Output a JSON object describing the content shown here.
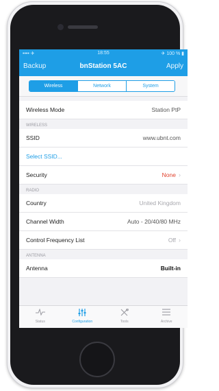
{
  "statusbar": {
    "left": "•••• ✈",
    "time": "18:55",
    "right": "✈ 100 % ▮"
  },
  "nav": {
    "back": "Backup",
    "title": "bnStation 5AC",
    "apply": "Apply"
  },
  "segments": [
    "Wireless",
    "Network",
    "System"
  ],
  "rows": {
    "wireless_mode": {
      "label": "Wireless Mode",
      "value": "Station PtP"
    },
    "section_wireless": "WIRELESS",
    "ssid": {
      "label": "SSID",
      "value": "www.ubnt.com"
    },
    "select_ssid": "Select SSID...",
    "security": {
      "label": "Security",
      "value": "None"
    },
    "section_radio": "RADIO",
    "country": {
      "label": "Country",
      "value": "United Kingdom"
    },
    "channel_width": {
      "label": "Channel Width",
      "value": "Auto - 20/40/80 MHz"
    },
    "control_freq": {
      "label": "Control Frequency List",
      "value": "Off"
    },
    "section_antenna": "ANTENNA",
    "antenna": {
      "label": "Antenna",
      "value": "Built-in"
    }
  },
  "tabbar": [
    {
      "label": "Status",
      "icon": "pulse-icon"
    },
    {
      "label": "Configuration",
      "icon": "sliders-icon"
    },
    {
      "label": "Tools",
      "icon": "tools-icon"
    },
    {
      "label": "Archive",
      "icon": "list-icon"
    }
  ],
  "colors": {
    "accent": "#1e9ee6",
    "warning": "#e0402c"
  }
}
